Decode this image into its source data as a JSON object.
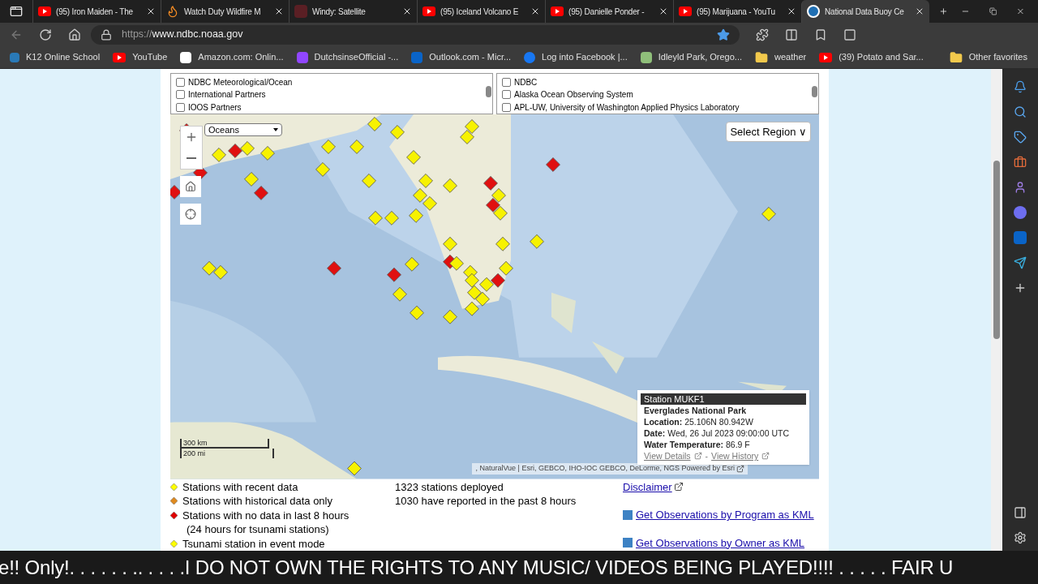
{
  "tabs": [
    {
      "title": "(95) Iron Maiden - The",
      "kind": "youtube",
      "selected": false
    },
    {
      "title": "Watch Duty Wildfire M",
      "kind": "fire",
      "selected": false
    },
    {
      "title": "Windy: Satellite",
      "kind": "windy",
      "selected": false
    },
    {
      "title": "(95) Iceland Volcano E",
      "kind": "youtube",
      "selected": false
    },
    {
      "title": "(95) Danielle Ponder -",
      "kind": "youtube",
      "selected": false
    },
    {
      "title": "(95) Marijuana - YouTu",
      "kind": "youtube",
      "selected": false
    },
    {
      "title": "National Data Buoy Ce",
      "kind": "noaa",
      "selected": true
    }
  ],
  "address": {
    "scheme": "https://",
    "host": "www.ndbc.noaa.gov"
  },
  "favorites": [
    {
      "label": "K12 Online School",
      "kind": "k12"
    },
    {
      "label": "YouTube",
      "kind": "youtube"
    },
    {
      "label": "Amazon.com: Onlin...",
      "kind": "amazon"
    },
    {
      "label": "DutchsinseOfficial -...",
      "kind": "twitch"
    },
    {
      "label": "Outlook.com - Micr...",
      "kind": "outlook"
    },
    {
      "label": "Log into Facebook |...",
      "kind": "facebook"
    },
    {
      "label": "Idleyld Park, Orego...",
      "kind": "site"
    },
    {
      "label": "weather",
      "kind": "folder"
    },
    {
      "label": "(39) Potato and Sar...",
      "kind": "youtube"
    }
  ],
  "other_favorites": "Other favorites",
  "filters": [
    {
      "items": [
        {
          "label": "NDBC Meteorological/Ocean",
          "checked": false
        },
        {
          "label": "International Partners",
          "checked": false
        },
        {
          "label": "IOOS Partners",
          "checked": false
        }
      ]
    },
    {
      "items": [
        {
          "label": "NDBC",
          "checked": false
        },
        {
          "label": "Alaska Ocean Observing System",
          "checked": false
        },
        {
          "label": "APL-UW, University of Washington Applied Physics Laboratory",
          "checked": false
        }
      ]
    }
  ],
  "map": {
    "layer_select": "Oceans",
    "region_button": "Select Region ∨",
    "scale": [
      "300 km",
      "200 mi"
    ],
    "attribution": ", NaturalVue | Esri, GEBCO, IHO-IOC GEBCO, DeLorme, NGS Powered by Esri",
    "popup": {
      "title": "Station MUKF1",
      "name": "Everglades National Park",
      "fields": [
        {
          "label": "Location:",
          "value": "25.106N 80.942W"
        },
        {
          "label": "Date:",
          "value": "Wed, 26 Jul 2023 09:00:00 UTC"
        },
        {
          "label": "Water Temperature:",
          "value": "86.9 F"
        }
      ],
      "links": [
        "View Details",
        "View History"
      ],
      "separator": "-"
    }
  },
  "legend": [
    {
      "label": "Stations with recent data",
      "color": "#ffff00"
    },
    {
      "label": "Stations with historical data only",
      "color": "#e08a1e"
    },
    {
      "label": "Stations with no data in last 8 hours",
      "note": "(24 hours for tsunami stations)",
      "color": "#e00000"
    },
    {
      "label": "Tsunami station in event mode",
      "color": "#ffff00"
    }
  ],
  "stats": [
    "1323 stations deployed",
    "1030 have reported in the past 8 hours"
  ],
  "links": [
    {
      "label": "Disclaimer",
      "kind": "external"
    },
    {
      "label": "Get Observations by Program as KML",
      "kind": "kml"
    },
    {
      "label": "Get Observations by Owner as KML",
      "kind": "kml"
    }
  ],
  "ticker": "e!! Only!. . . . . . .. . . . .I DO NOT OWN THE RIGHTS TO ANY MUSIC/ VIDEOS BEING PLAYED!!!! . . . . . FAIR U"
}
